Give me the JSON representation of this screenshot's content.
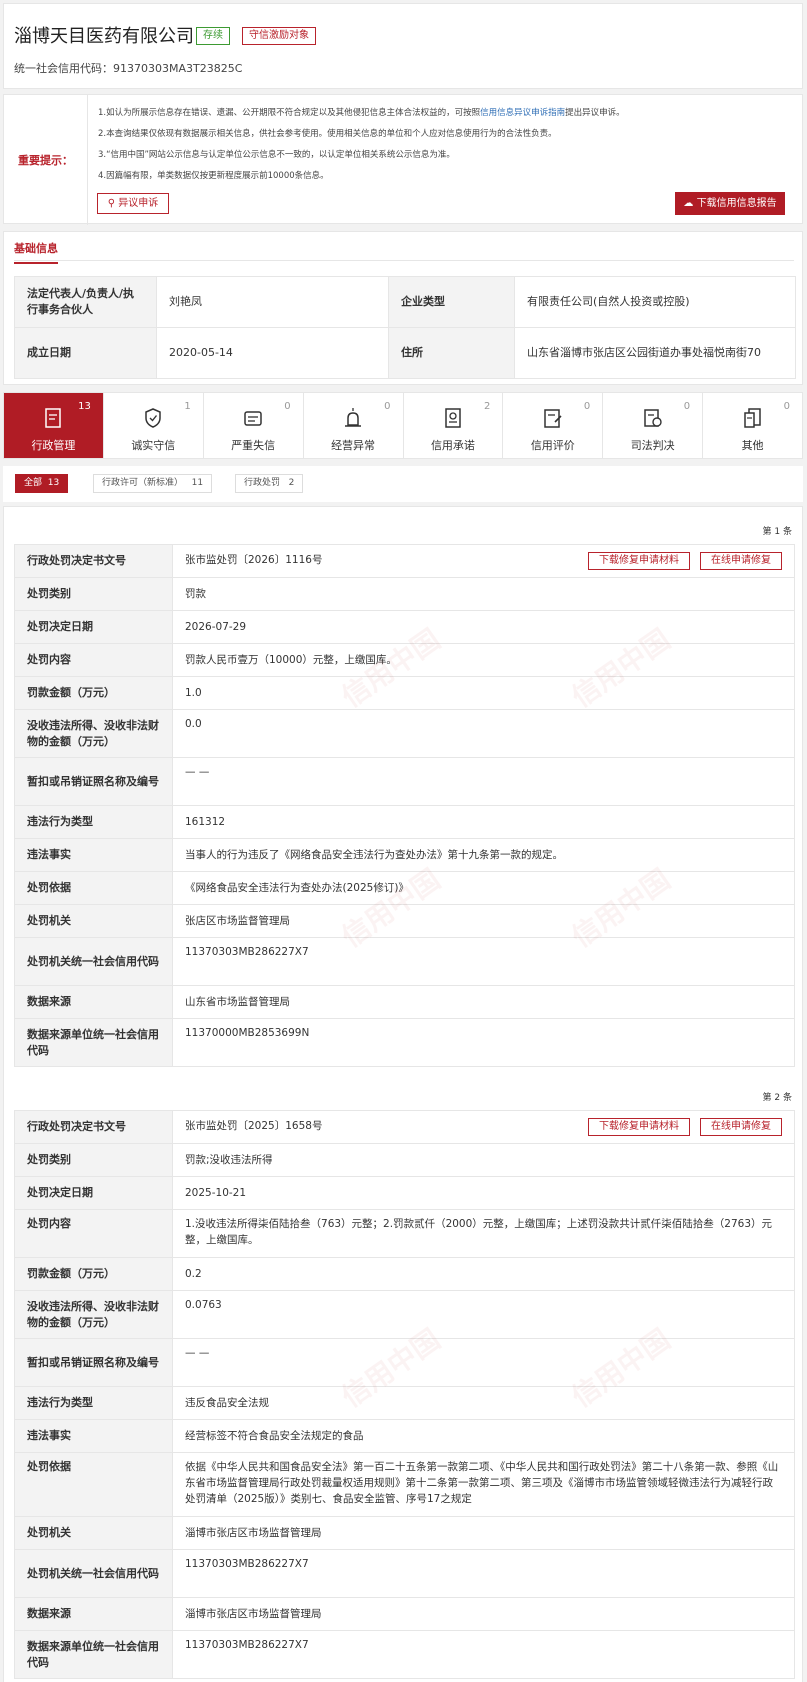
{
  "header": {
    "company_name": "淄博天目医药有限公司",
    "status_tag": "存续",
    "honor_tag": "守信激励对象",
    "credit_code_label": "统一社会信用代码：",
    "credit_code": "91370303MA3T23825C"
  },
  "notice": {
    "title": "重要提示：",
    "lines": [
      {
        "text": "1.如认为所展示信息存在错误、遗漏、公开期限不符合规定以及其他侵犯信息主体合法权益的，可按照",
        "link": "信用信息异议申诉指南",
        "after": "提出异议申诉。"
      },
      {
        "text": "2.本查询结果仅依现有数据展示相关信息，供社会参考使用。使用相关信息的单位和个人应对信息使用行为的合法性负责。",
        "link": "",
        "after": ""
      },
      {
        "text": "3.“信用中国”网站公示信息与认定单位公示信息不一致的，以认定单位相关系统公示信息为准。",
        "link": "",
        "after": ""
      },
      {
        "text": "4.因篇幅有限，单类数据仅按更新程度展示前10000条信息。",
        "link": "",
        "after": ""
      }
    ],
    "objection_button": "异议申诉",
    "download_button": "下载信用信息报告"
  },
  "basic": {
    "tab_label": "基础信息",
    "rows": [
      {
        "k1": "法定代表人/负责人/执行事务合伙人",
        "v1": "刘艳凤",
        "k2": "企业类型",
        "v2": "有限责任公司(自然人投资或控股)"
      },
      {
        "k1": "成立日期",
        "v1": "2020-05-14",
        "k2": "住所",
        "v2": "山东省淄博市张店区公园街道办事处福悦南街70"
      }
    ]
  },
  "categories": [
    {
      "label": "行政管理",
      "count": "13",
      "icon": "admin-icon"
    },
    {
      "label": "诚实守信",
      "count": "1",
      "icon": "shield-icon"
    },
    {
      "label": "严重失信",
      "count": "0",
      "icon": "blacklist-icon"
    },
    {
      "label": "经营异常",
      "count": "0",
      "icon": "alarm-icon"
    },
    {
      "label": "信用承诺",
      "count": "2",
      "icon": "commitment-icon"
    },
    {
      "label": "信用评价",
      "count": "0",
      "icon": "evaluation-icon"
    },
    {
      "label": "司法判决",
      "count": "0",
      "icon": "judgment-icon"
    },
    {
      "label": "其他",
      "count": "0",
      "icon": "other-icon"
    }
  ],
  "filters": [
    {
      "label": "全部",
      "count": "13"
    },
    {
      "label": "行政许可（新标准）",
      "count": "11"
    },
    {
      "label": "行政处罚",
      "count": "2"
    }
  ],
  "watermark": "信用中国",
  "records": [
    {
      "index_label": "第 1 条",
      "repair_download": "下载修复申请材料",
      "repair_online": "在线申请修复",
      "fields": [
        {
          "k": "行政处罚决定书文号",
          "v": "张市监处罚〔2026〕1116号"
        },
        {
          "k": "处罚类别",
          "v": "罚款"
        },
        {
          "k": "处罚决定日期",
          "v": "2026-07-29"
        },
        {
          "k": "处罚内容",
          "v": "罚款人民币壹万（10000）元整，上缴国库。"
        },
        {
          "k": "罚款金额（万元）",
          "v": "1.0"
        },
        {
          "k": "没收违法所得、没收非法财物的金额（万元）",
          "v": "0.0"
        },
        {
          "k": "暂扣或吊销证照名称及编号",
          "v": "— —"
        },
        {
          "k": "违法行为类型",
          "v": "161312"
        },
        {
          "k": "违法事实",
          "v": "当事人的行为违反了《网络食品安全违法行为查处办法》第十九条第一款的规定。"
        },
        {
          "k": "处罚依据",
          "v": "《网络食品安全违法行为查处办法(2025修订)》"
        },
        {
          "k": "处罚机关",
          "v": "张店区市场监督管理局"
        },
        {
          "k": "处罚机关统一社会信用代码",
          "v": "11370303MB286227X7"
        },
        {
          "k": "数据来源",
          "v": "山东省市场监督管理局"
        },
        {
          "k": "数据来源单位统一社会信用代码",
          "v": "11370000MB2853699N"
        }
      ]
    },
    {
      "index_label": "第 2 条",
      "repair_download": "下载修复申请材料",
      "repair_online": "在线申请修复",
      "fields": [
        {
          "k": "行政处罚决定书文号",
          "v": "张市监处罚〔2025〕1658号"
        },
        {
          "k": "处罚类别",
          "v": "罚款;没收违法所得"
        },
        {
          "k": "处罚决定日期",
          "v": "2025-10-21"
        },
        {
          "k": "处罚内容",
          "v": "1.没收违法所得柒佰陆拾叁（763）元整；2.罚款贰仟（2000）元整，上缴国库；上述罚没款共计贰仟柒佰陆拾叁（2763）元整，上缴国库。"
        },
        {
          "k": "罚款金额（万元）",
          "v": "0.2"
        },
        {
          "k": "没收违法所得、没收非法财物的金额（万元）",
          "v": "0.0763"
        },
        {
          "k": "暂扣或吊销证照名称及编号",
          "v": "— —"
        },
        {
          "k": "违法行为类型",
          "v": "违反食品安全法规"
        },
        {
          "k": "违法事实",
          "v": "经营标签不符合食品安全法规定的食品"
        },
        {
          "k": "处罚依据",
          "v": "依据《中华人民共和国食品安全法》第一百二十五条第一款第二项、《中华人民共和国行政处罚法》第二十八条第一款、参照《山东省市场监督管理局行政处罚裁量权适用规则》第十二条第一款第二项、第三项及《淄博市市场监管领域轻微违法行为减轻行政处罚清单（2025版）》类别七、食品安全监管、序号17之规定"
        },
        {
          "k": "处罚机关",
          "v": "淄博市张店区市场监督管理局"
        },
        {
          "k": "处罚机关统一社会信用代码",
          "v": "11370303MB286227X7"
        },
        {
          "k": "数据来源",
          "v": "淄博市张店区市场监督管理局"
        },
        {
          "k": "数据来源单位统一社会信用代码",
          "v": "11370303MB286227X7"
        }
      ]
    }
  ]
}
